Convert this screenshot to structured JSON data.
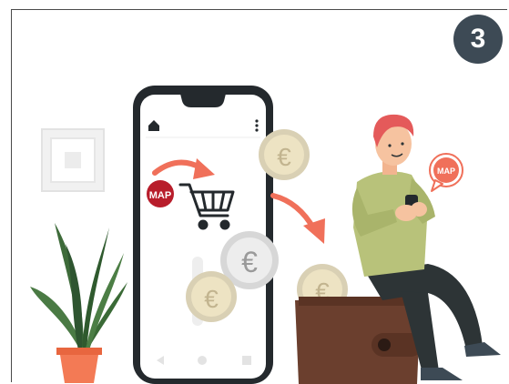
{
  "step": {
    "number": "3"
  },
  "phone": {
    "badge_label": "MAP",
    "nav_icons": [
      "back-triangle-icon",
      "home-circle-icon",
      "recent-square-icon"
    ],
    "header_icons": [
      "home-icon",
      "kebab-menu-icon"
    ]
  },
  "person": {
    "chat_badge_label": "MAP"
  },
  "colors": {
    "step_badge": "#3d4a55",
    "map_red": "#b81d2b",
    "arrow_coral": "#f0705a",
    "wallet_brown": "#6b3f2e",
    "coin_silver": "#d7d7d7",
    "coin_gold": "#ede3c3",
    "shirt_green": "#b8c27a",
    "pants_dark": "#2d3436",
    "hair_red": "#e45a5a",
    "pot_orange": "#f37a55",
    "leaf_green": "#3e6b3a"
  }
}
